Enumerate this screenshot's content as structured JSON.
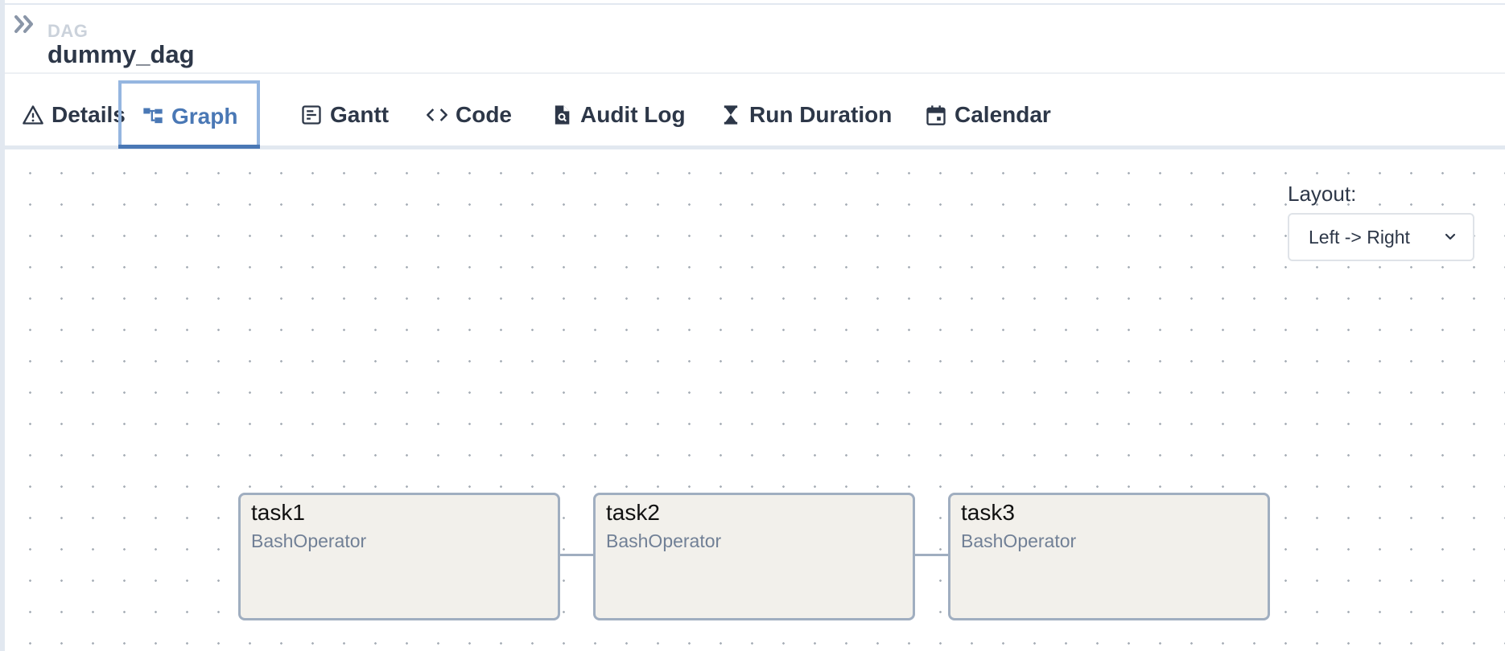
{
  "breadcrumb": {
    "label": "DAG",
    "title": "dummy_dag"
  },
  "tabs": [
    {
      "label": "Details",
      "icon": "warning-triangle-icon"
    },
    {
      "label": "Graph",
      "icon": "graph-icon",
      "active": true
    },
    {
      "label": "Gantt",
      "icon": "gantt-icon"
    },
    {
      "label": "Code",
      "icon": "code-icon"
    },
    {
      "label": "Audit Log",
      "icon": "file-search-icon"
    },
    {
      "label": "Run Duration",
      "icon": "hourglass-icon"
    },
    {
      "label": "Calendar",
      "icon": "calendar-icon"
    }
  ],
  "layout_control": {
    "label": "Layout:",
    "value": "Left -> Right"
  },
  "graph": {
    "nodes": [
      {
        "id": "task1",
        "operator": "BashOperator"
      },
      {
        "id": "task2",
        "operator": "BashOperator"
      },
      {
        "id": "task3",
        "operator": "BashOperator"
      }
    ],
    "edges": [
      [
        "task1",
        "task2"
      ],
      [
        "task2",
        "task3"
      ]
    ]
  },
  "colors": {
    "accent": "#4a78b5",
    "node_bg": "#f2f0eb",
    "node_border": "#a0aec0",
    "operator_text": "#718096"
  }
}
